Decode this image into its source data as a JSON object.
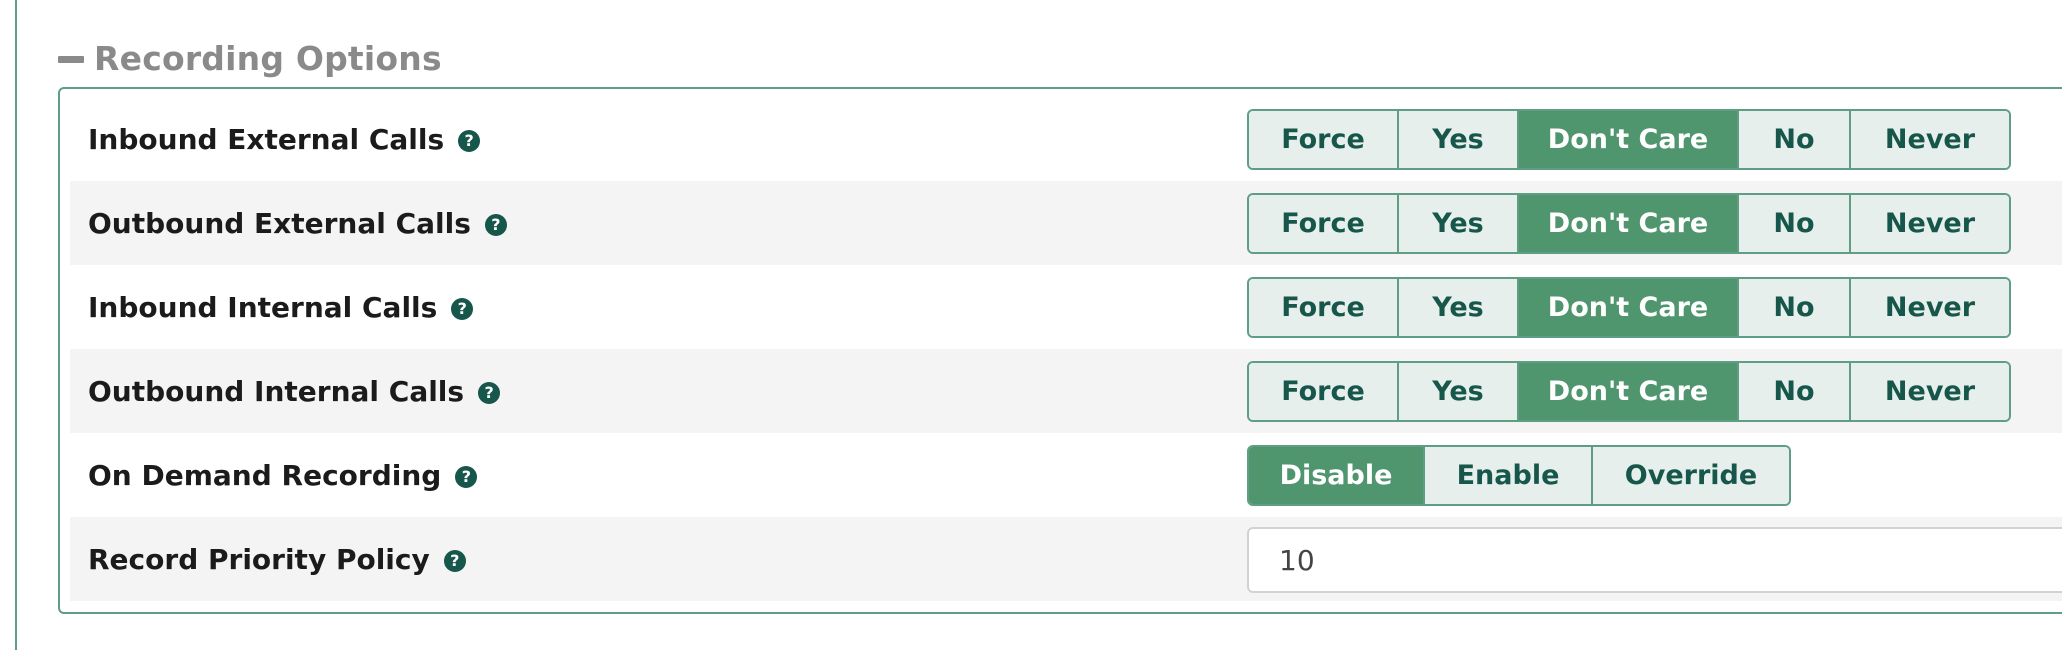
{
  "section": {
    "title": "Recording Options"
  },
  "rows": [
    {
      "label": "Inbound External Calls",
      "options": [
        "Force",
        "Yes",
        "Don't Care",
        "No",
        "Never"
      ],
      "selected": "Don't Care"
    },
    {
      "label": "Outbound External Calls",
      "options": [
        "Force",
        "Yes",
        "Don't Care",
        "No",
        "Never"
      ],
      "selected": "Don't Care"
    },
    {
      "label": "Inbound Internal Calls",
      "options": [
        "Force",
        "Yes",
        "Don't Care",
        "No",
        "Never"
      ],
      "selected": "Don't Care"
    },
    {
      "label": "Outbound Internal Calls",
      "options": [
        "Force",
        "Yes",
        "Don't Care",
        "No",
        "Never"
      ],
      "selected": "Don't Care"
    },
    {
      "label": "On Demand Recording",
      "options": [
        "Disable",
        "Enable",
        "Override"
      ],
      "selected": "Disable"
    },
    {
      "label": "Record Priority Policy",
      "value": "10"
    }
  ],
  "icons": {
    "collapse": "minus-icon",
    "help": "question-circle-icon",
    "help_glyph": "?"
  },
  "colors": {
    "accent": "#4f956d",
    "border": "#5f9e84",
    "button_bg": "#e6efeb",
    "button_text": "#17564b",
    "header_text": "#8a8a8a"
  }
}
